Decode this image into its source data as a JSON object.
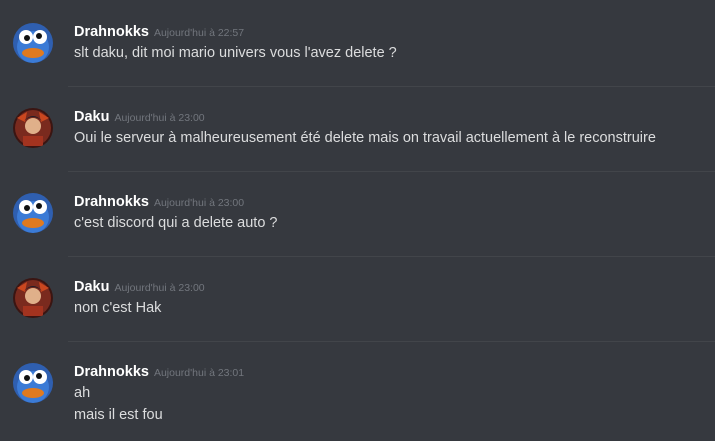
{
  "messages": [
    {
      "author": "Drahnokks",
      "timestamp": "Aujourd'hui à 22:57",
      "avatar_icon": "blue-cookie-monster-avatar",
      "lines": [
        "slt daku, dit moi mario univers vous l'avez delete ?"
      ]
    },
    {
      "author": "Daku",
      "timestamp": "Aujourd'hui à 23:00",
      "avatar_icon": "red-anime-avatar",
      "lines": [
        "Oui le serveur à malheureusement été delete mais on travail actuellement à le reconstruire"
      ]
    },
    {
      "author": "Drahnokks",
      "timestamp": "Aujourd'hui à 23:00",
      "avatar_icon": "blue-cookie-monster-avatar",
      "lines": [
        "c'est discord qui a delete auto ?"
      ]
    },
    {
      "author": "Daku",
      "timestamp": "Aujourd'hui à 23:00",
      "avatar_icon": "red-anime-avatar",
      "lines": [
        "non c'est Hak"
      ]
    },
    {
      "author": "Drahnokks",
      "timestamp": "Aujourd'hui à 23:01",
      "avatar_icon": "blue-cookie-monster-avatar",
      "lines": [
        "ah",
        "mais il est fou"
      ]
    }
  ],
  "colors": {
    "background": "#36393f",
    "username": "#ffffff",
    "timestamp": "#72767d",
    "message_text": "#dcddde",
    "divider": "#42454a"
  }
}
